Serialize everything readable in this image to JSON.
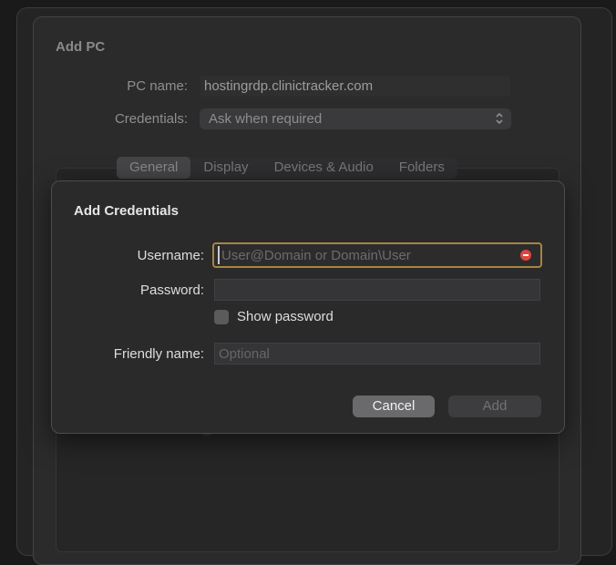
{
  "add_pc": {
    "title": "Add PC",
    "pc_name_label": "PC name:",
    "pc_name_value": "hostingrdp.clinictracker.com",
    "credentials_label": "Credentials:",
    "credentials_value": "Ask when required",
    "tabs": [
      "General",
      "Display",
      "Devices & Audio",
      "Folders"
    ],
    "selected_tab": "General"
  },
  "dialog": {
    "title": "Add Credentials",
    "username_label": "Username:",
    "username_placeholder": "User@Domain or Domain\\User",
    "username_value": "",
    "password_label": "Password:",
    "password_value": "",
    "show_password_label": "Show password",
    "show_password_checked": false,
    "friendly_name_label": "Friendly name:",
    "friendly_name_placeholder": "Optional",
    "cancel_label": "Cancel",
    "add_label": "Add"
  },
  "colors": {
    "focus_ring": "#a88441",
    "error_badge": "#e0453f"
  }
}
